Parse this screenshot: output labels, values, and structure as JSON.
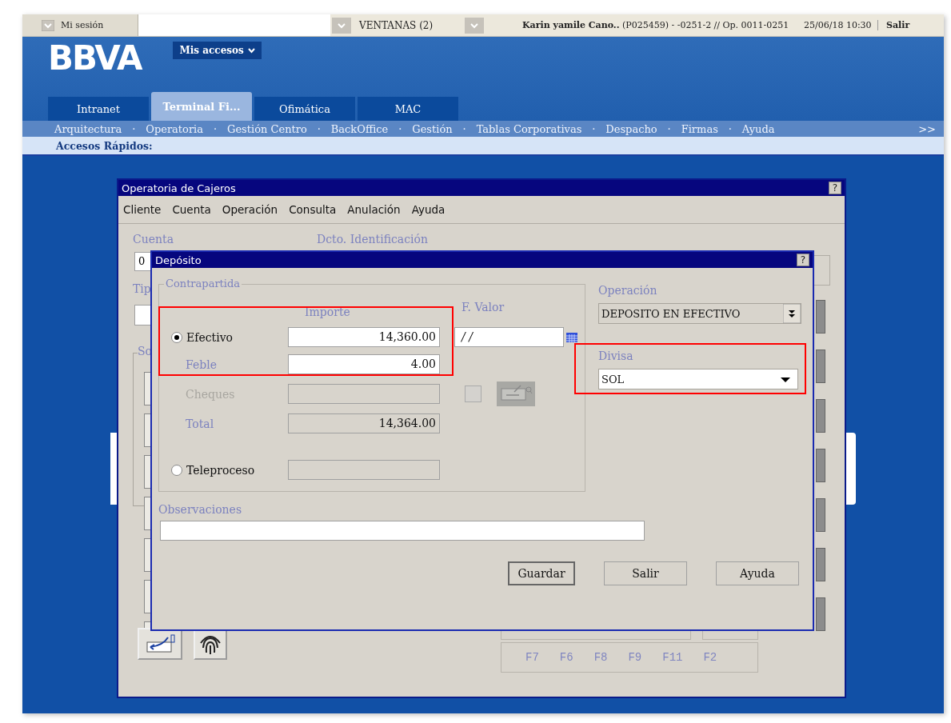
{
  "top_bar": {
    "session": "Mi sesión",
    "windows": "VENTANAS (2)",
    "user": "**Karin yamile Cano..** (P025459) - -0251-2 // Op. 0011-0251",
    "datetime": "25/06/18 10:30",
    "exit": "Salir"
  },
  "header": {
    "logo": "BBVA",
    "access_button": "Mis accesos"
  },
  "tabs": [
    {
      "label": "Intranet",
      "selected": false
    },
    {
      "label": "Terminal Fi...",
      "selected": true
    },
    {
      "label": "Ofimática",
      "selected": false
    },
    {
      "label": "MAC",
      "selected": false
    }
  ],
  "nav": {
    "items": [
      "Arquitectura",
      "Operatoria",
      "Gestión Centro",
      "BackOffice",
      "Gestión",
      "Tablas Corporativas",
      "Despacho",
      "Firmas",
      "Ayuda"
    ],
    "separator": "·",
    "more": ">>"
  },
  "quick_access": "Accesos Rápidos:",
  "main_window": {
    "title": "Operatoria de Cajeros",
    "help": "?",
    "menu": [
      "Cliente",
      "Cuenta",
      "Operación",
      "Consulta",
      "Anulación",
      "Ayuda"
    ],
    "account_label": "Cuenta",
    "account_value": "0",
    "id_label": "Dcto. Identificación",
    "type_label": "Tip",
    "section_label": "So",
    "function_keys": [
      "F7",
      "F6",
      "F8",
      "F9",
      "F11",
      "F2"
    ]
  },
  "dialog": {
    "title": "Depósito",
    "help": "?",
    "group_title": "Contrapartida",
    "amount_header": "Importe",
    "date_header": "F. Valor",
    "rows": [
      {
        "kind": "radio",
        "label": "Efectivo",
        "selected": true,
        "value": "14,360.00",
        "date": "/  /"
      },
      {
        "kind": "field",
        "label": "Feble",
        "value": "4.00"
      },
      {
        "kind": "cheques",
        "label": "Cheques",
        "checked": false
      },
      {
        "kind": "total",
        "label": "Total",
        "value": "14,364.00"
      },
      {
        "kind": "radio",
        "label": "Teleproceso",
        "selected": false
      }
    ],
    "operation_label": "Operación",
    "operation_value": "DEPOSITO EN EFECTIVO",
    "currency_label": "Divisa",
    "currency_value": "SOL",
    "notes_label": "Observaciones",
    "buttons": [
      {
        "label": "Guardar",
        "default": true
      },
      {
        "label": "Salir",
        "default": false
      },
      {
        "label": "Ayuda",
        "default": false
      }
    ]
  }
}
